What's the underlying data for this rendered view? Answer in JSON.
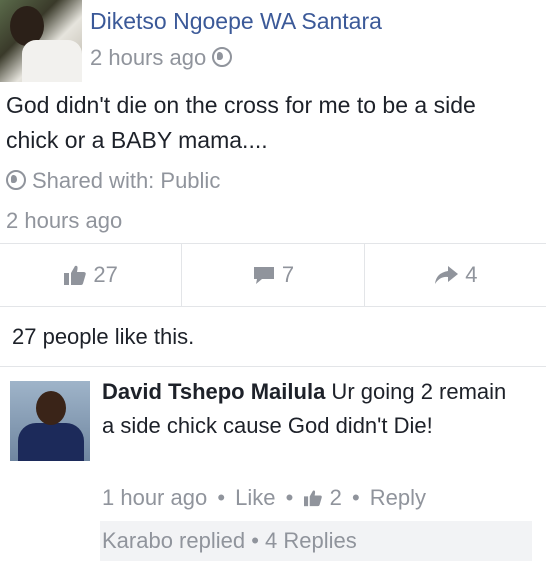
{
  "post": {
    "author": "Diketso Ngoepe WA Santara",
    "time": "2 hours ago",
    "text": "God didn't die on the cross for me to be a side chick or a BABY mama....",
    "shared_with": "Shared with: Public",
    "time_detail": "2 hours ago"
  },
  "actions": {
    "likes": "27",
    "comments": "7",
    "shares": "4"
  },
  "likes_summary": "27 people like this.",
  "comment": {
    "author": "David Tshepo Mailula",
    "text": " Ur going 2 remain a side chick cause God didn't Die!",
    "time": "1 hour ago",
    "sep": "•",
    "like_label": "Like",
    "like_count": "2",
    "reply_label": "Reply",
    "replies_summary": "Karabo replied • 4 Replies"
  },
  "icons": {
    "like": "thumbs-up-icon",
    "comment": "comment-icon",
    "share": "share-arrow-icon",
    "globe": "globe-icon"
  },
  "colors": {
    "link_blue": "#3b5998",
    "meta_gray": "#90949c"
  }
}
